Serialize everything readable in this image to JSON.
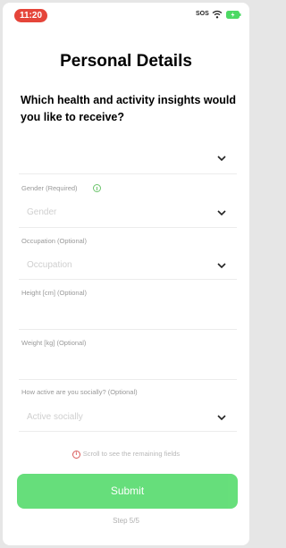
{
  "status_bar": {
    "time": "11:20",
    "network": "SOS"
  },
  "page": {
    "title": "Personal Details",
    "question": "Which health and activity insights would you like to receive?"
  },
  "fields": {
    "insights": {
      "value": ""
    },
    "gender": {
      "label": "Gender (Required)",
      "placeholder": "Gender"
    },
    "occupation": {
      "label": "Occupation (Optional)",
      "placeholder": "Occupation"
    },
    "height": {
      "label": "Height [cm] (Optional)",
      "value": ""
    },
    "weight": {
      "label": "Weight [kg] (Optional)",
      "value": ""
    },
    "social": {
      "label": "How active are you socially? (Optional)",
      "placeholder": "Active socially"
    }
  },
  "hint": {
    "text": "Scroll to see the remaining fields"
  },
  "footer": {
    "submit_label": "Submit",
    "step": "Step 5/5"
  },
  "colors": {
    "accent": "#4cd964",
    "time_pill": "#e5453a",
    "hint_icon": "#d95757"
  },
  "icons": [
    "wifi-icon",
    "battery-icon",
    "chevron-down-icon",
    "info-icon",
    "alert-icon"
  ]
}
